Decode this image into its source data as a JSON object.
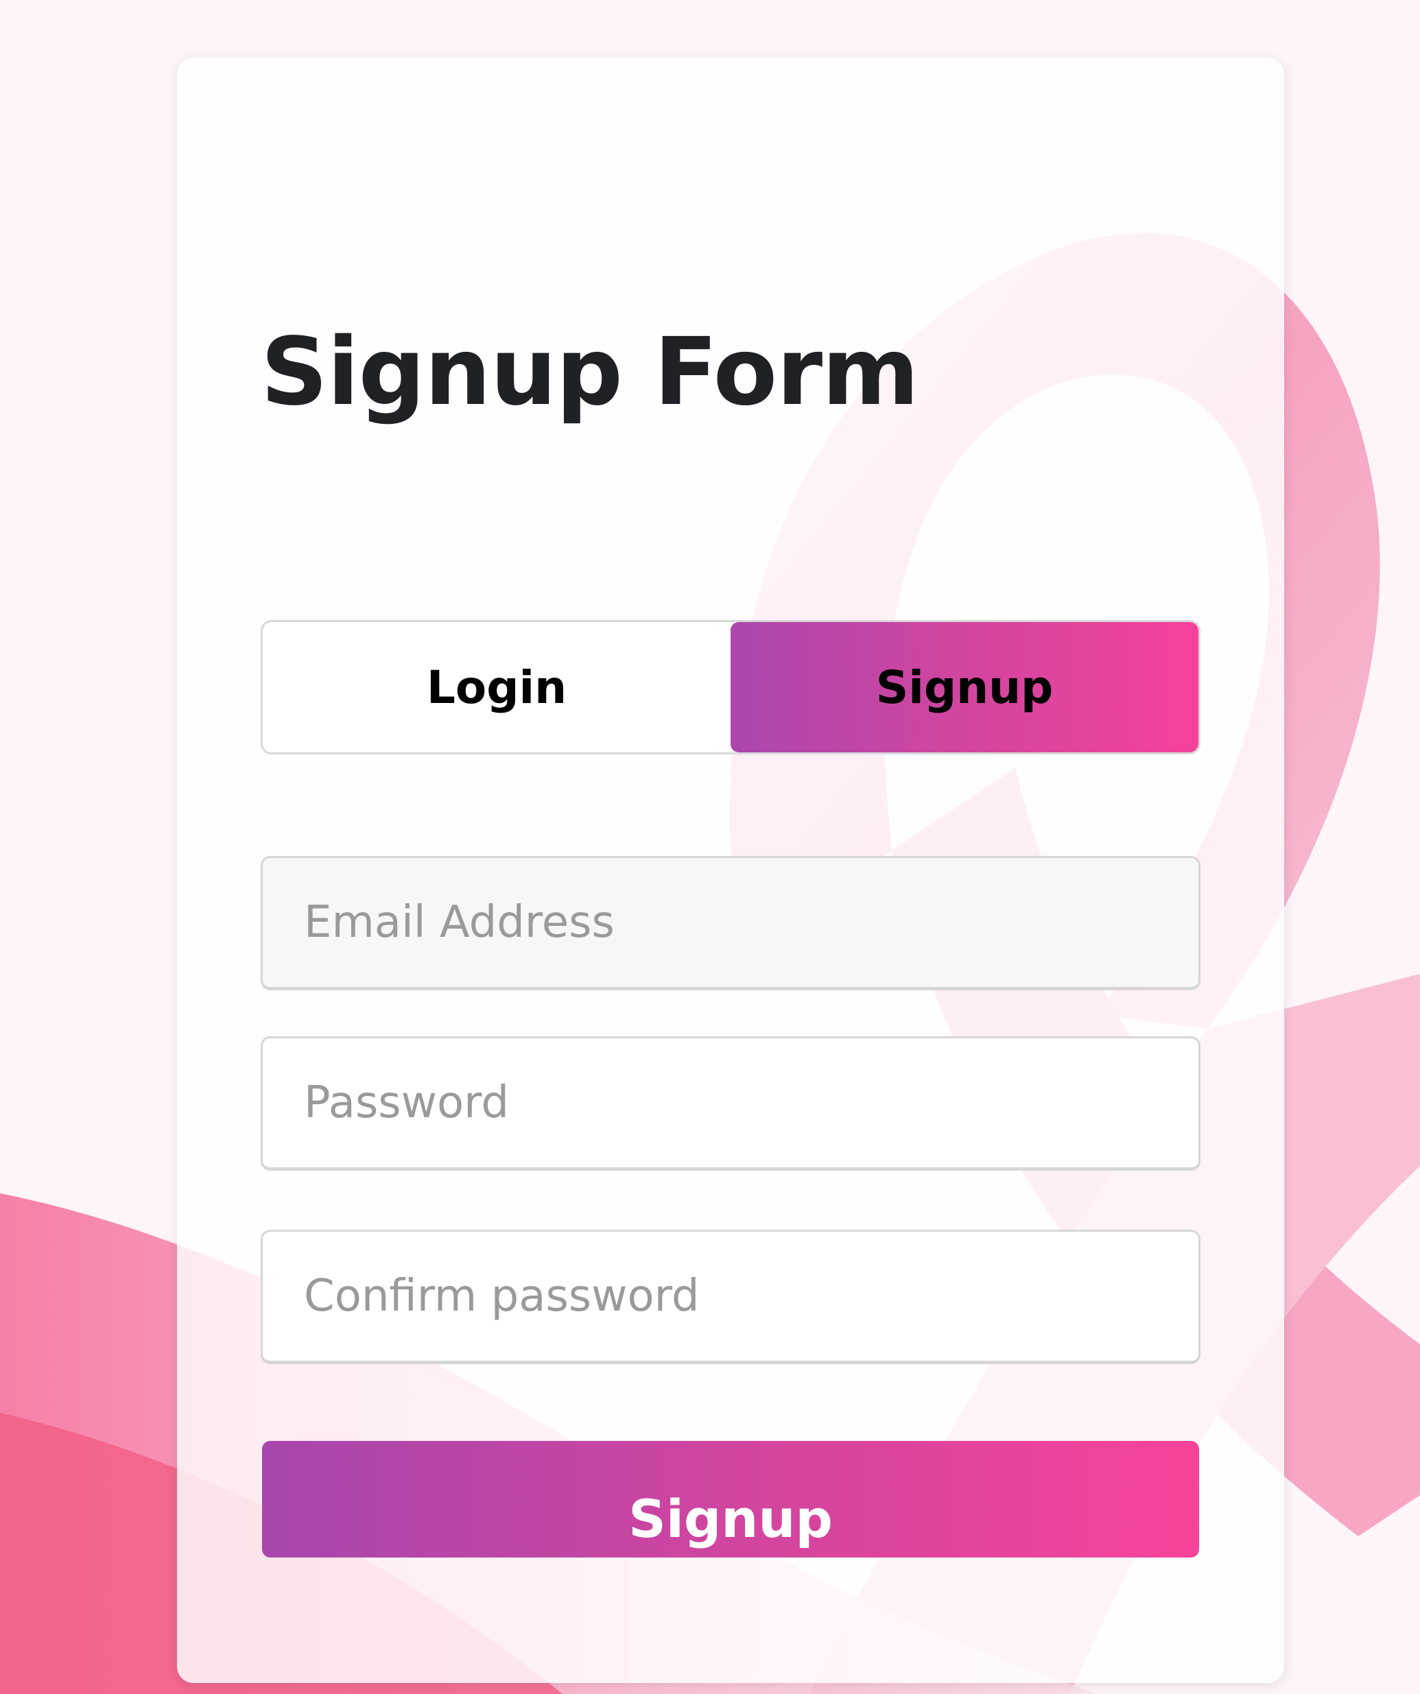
{
  "form": {
    "title": "Signup Form",
    "tabs": [
      {
        "label": "Login",
        "active": false
      },
      {
        "label": "Signup",
        "active": true
      }
    ],
    "fields": {
      "email": {
        "placeholder": "Email Address",
        "value": ""
      },
      "password": {
        "placeholder": "Password",
        "value": ""
      },
      "confirm": {
        "placeholder": "Confirm password",
        "value": ""
      }
    },
    "submit_label": "Signup"
  },
  "colors": {
    "gradient_start": "#a746ad",
    "gradient_end": "#f7439a",
    "ribbon_pink": "#f7a9c6",
    "title_text": "#1f2125"
  },
  "background": {
    "image_subject": "pink-awareness-ribbon"
  }
}
